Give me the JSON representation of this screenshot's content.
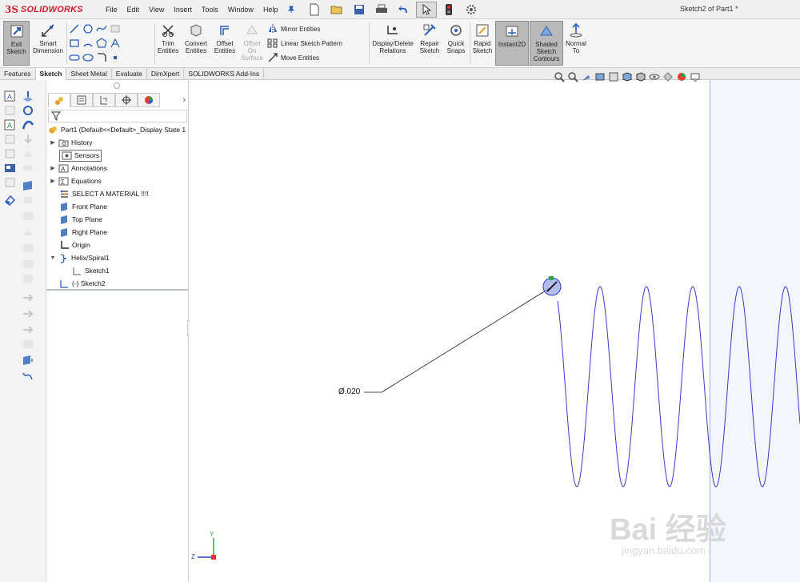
{
  "app": {
    "logo_ds": "3S",
    "logo_name": "SOLIDWORKS",
    "window_title": "Sketch2 of Part1 *",
    "menu": [
      "File",
      "Edit",
      "View",
      "Insert",
      "Tools",
      "Window",
      "Help"
    ]
  },
  "ribbon": {
    "exit_sketch": [
      "Exit",
      "Sketch"
    ],
    "smart_dimension": [
      "Smart",
      "Dimension"
    ],
    "trim": [
      "Trim",
      "Entities"
    ],
    "convert": [
      "Convert",
      "Entities"
    ],
    "offset": [
      "Offset",
      "Entities"
    ],
    "offset_surface": [
      "Offset",
      "On",
      "Surface"
    ],
    "mirror": "Mirror Entities",
    "linear_pattern": "Linear Sketch Pattern",
    "move": "Move Entities",
    "display_delete": [
      "Display/Delete",
      "Relations"
    ],
    "repair": [
      "Repair",
      "Sketch"
    ],
    "quick_snaps": [
      "Quick",
      "Snaps"
    ],
    "rapid": [
      "Rapid",
      "Sketch"
    ],
    "instant2d": "Instant2D",
    "shaded_contours": [
      "Shaded",
      "Sketch",
      "Contours"
    ],
    "normal_to": [
      "Normal",
      "To"
    ]
  },
  "tabs": [
    "Features",
    "Sketch",
    "Sheet Metal",
    "Evaluate",
    "DimXpert",
    "SOLIDWORKS Add-Ins"
  ],
  "tree": {
    "root": "Part1  (Default<<Default>_Display State 1",
    "items": [
      "History",
      "Sensors",
      "Annotations",
      "Equations",
      "SELECT A MATERIAL !!!!",
      "Front Plane",
      "Top Plane",
      "Right Plane",
      "Origin",
      "Helix/Spiral1",
      "Sketch1",
      "(-) Sketch2"
    ]
  },
  "canvas": {
    "dimension_label": "Ø.020",
    "axis_y": "Y",
    "axis_z": "Z",
    "watermark": "Bai 经验",
    "watermark_url": "jingyan.baidu.com"
  },
  "colors": {
    "accent": "#d11f2e",
    "sketch_blue": "#3a3ad0",
    "selected_blue": "#3a52c8"
  }
}
